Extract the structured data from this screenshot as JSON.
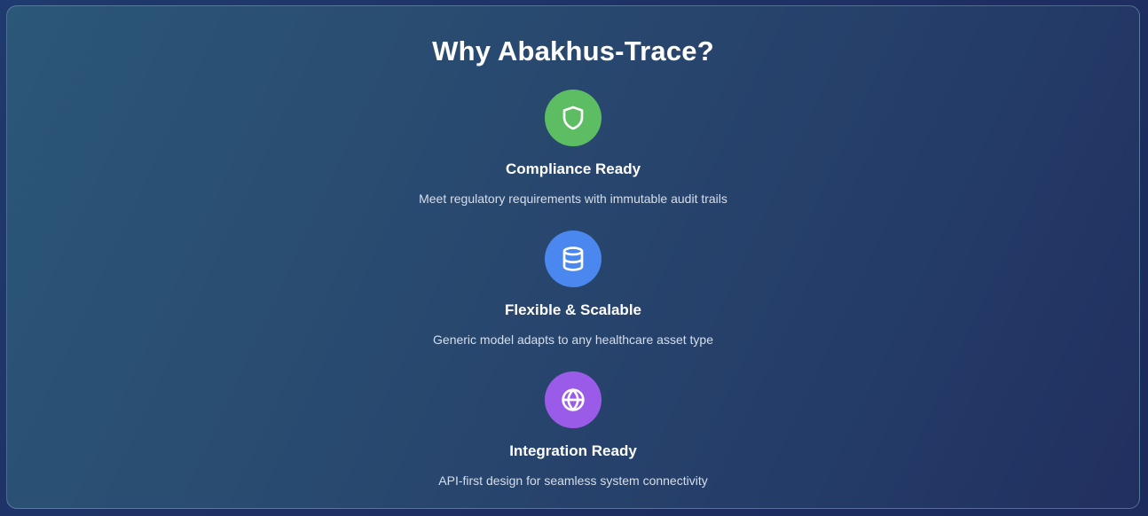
{
  "section": {
    "title": "Why Abakhus-Trace?"
  },
  "features": [
    {
      "icon": "shield-icon",
      "icon_color": "#5cbd62",
      "title": "Compliance Ready",
      "description": "Meet regulatory requirements with immutable audit trails"
    },
    {
      "icon": "database-icon",
      "icon_color": "#4a87ee",
      "title": "Flexible & Scalable",
      "description": "Generic model adapts to any healthcare asset type"
    },
    {
      "icon": "globe-icon",
      "icon_color": "#9a5ce8",
      "title": "Integration Ready",
      "description": "API-first design for seamless system connectivity"
    }
  ]
}
